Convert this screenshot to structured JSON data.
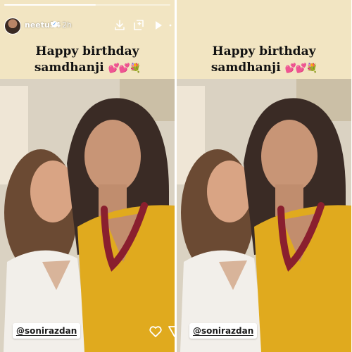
{
  "story": {
    "progress": 0.55,
    "username": "neetu54",
    "timestamp": "2h",
    "caption_line1": "Happy birthday",
    "caption_line2": "samdhanji",
    "caption_emoji": "💕💕💐",
    "mention": "@sonirazdan"
  },
  "icons": {
    "download": "download-icon",
    "add_to_story": "add-to-story-icon",
    "play": "play-icon",
    "heart": "heart-icon",
    "share": "send-icon",
    "verified": "verified-badge-icon"
  },
  "colors": {
    "banner": "#f2e5c2",
    "yellow_top": "#e0aa1e",
    "necklace": "#8a1f2e",
    "text": "#121212",
    "emoji_pink": "#e93d8f"
  }
}
